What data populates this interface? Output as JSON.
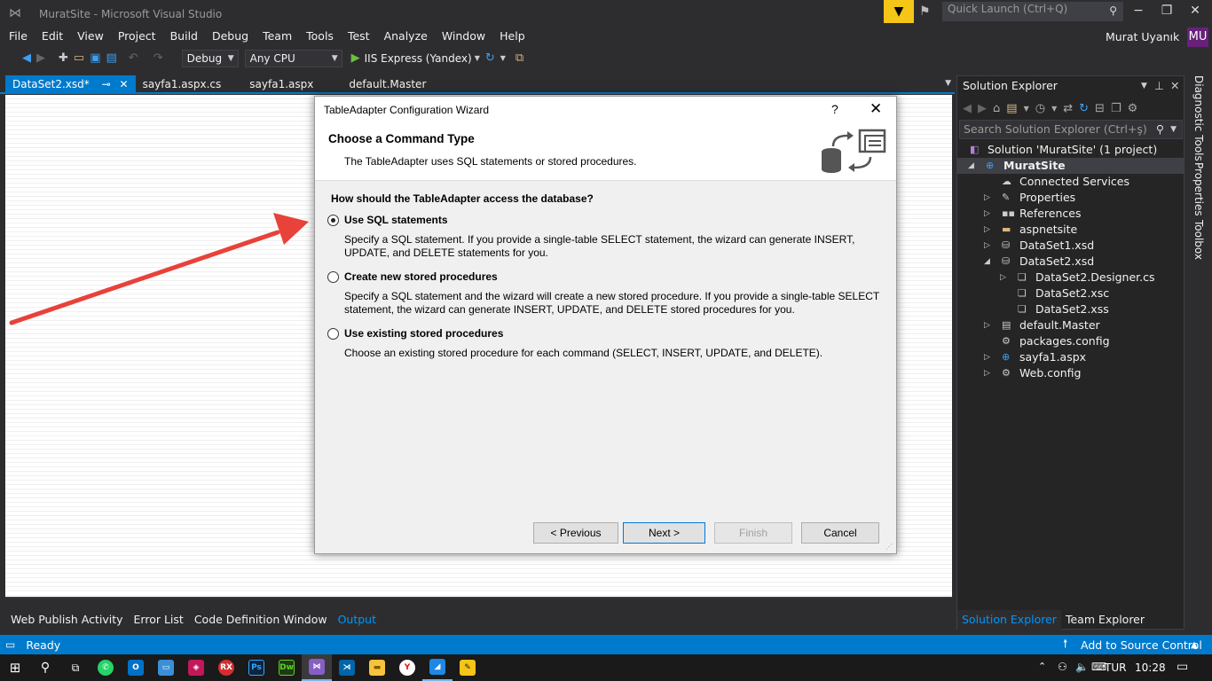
{
  "window": {
    "title": "MuratSite - Microsoft Visual Studio",
    "quick_launch_placeholder": "Quick Launch (Ctrl+Q)",
    "user_name": "Murat Uyanık",
    "user_initials": "MU"
  },
  "menu": [
    "File",
    "Edit",
    "View",
    "Project",
    "Build",
    "Debug",
    "Team",
    "Tools",
    "Test",
    "Analyze",
    "Window",
    "Help"
  ],
  "toolbar": {
    "config": "Debug",
    "platform": "Any CPU",
    "run_target": "IIS Express (Yandex)"
  },
  "tabs": [
    {
      "label": "DataSet2.xsd*",
      "pin": "⊸"
    },
    {
      "label": "sayfa1.aspx.cs"
    },
    {
      "label": "sayfa1.aspx"
    },
    {
      "label": "default.Master"
    }
  ],
  "bottom_tabs": [
    "Web Publish Activity",
    "Error List",
    "Code Definition Window",
    "Output"
  ],
  "status": {
    "left": "Ready",
    "right": "Add to Source Control"
  },
  "solution_explorer": {
    "title": "Solution Explorer",
    "search_placeholder": "Search Solution Explorer (Ctrl+ş)",
    "nodes": [
      {
        "label": "Solution 'MuratSite' (1 project)"
      },
      {
        "label": "MuratSite"
      },
      {
        "label": "Connected Services"
      },
      {
        "label": "Properties"
      },
      {
        "label": "References"
      },
      {
        "label": "aspnetsite"
      },
      {
        "label": "DataSet1.xsd"
      },
      {
        "label": "DataSet2.xsd"
      },
      {
        "label": "DataSet2.Designer.cs"
      },
      {
        "label": "DataSet2.xsc"
      },
      {
        "label": "DataSet2.xss"
      },
      {
        "label": "default.Master"
      },
      {
        "label": "packages.config"
      },
      {
        "label": "sayfa1.aspx"
      },
      {
        "label": "Web.config"
      }
    ],
    "bottom_tabs": [
      "Solution Explorer",
      "Team Explorer"
    ]
  },
  "side_tabs": [
    "Diagnostic Tools",
    "Properties",
    "Toolbox"
  ],
  "dialog": {
    "title": "TableAdapter Configuration Wizard",
    "help": "?",
    "heading": "Choose a Command Type",
    "subheading": "The TableAdapter uses SQL statements or stored procedures.",
    "question": "How should the TableAdapter access the database?",
    "options": [
      {
        "label": "Use SQL statements",
        "desc": "Specify a SQL statement. If you provide a single-table SELECT statement, the wizard can generate INSERT, UPDATE, and DELETE statements for you.",
        "selected": true
      },
      {
        "label": "Create new stored procedures",
        "desc": "Specify a SQL statement and the wizard will create a new stored procedure. If you provide a single-table SELECT statement, the wizard can generate INSERT, UPDATE, and DELETE stored procedures for you.",
        "selected": false
      },
      {
        "label": "Use existing stored procedures",
        "desc": "Choose an existing stored procedure for each command (SELECT, INSERT, UPDATE, and DELETE).",
        "selected": false
      }
    ],
    "buttons": {
      "previous": "< Previous",
      "next": "Next >",
      "finish": "Finish",
      "cancel": "Cancel"
    }
  },
  "taskbar": {
    "lang": "TUR",
    "time": "10:28",
    "apps": [
      "RX",
      "Ps",
      "Dw"
    ]
  },
  "colors": {
    "accent": "#007acc",
    "arrow": "#e8423a",
    "filter": "#f5c518"
  }
}
